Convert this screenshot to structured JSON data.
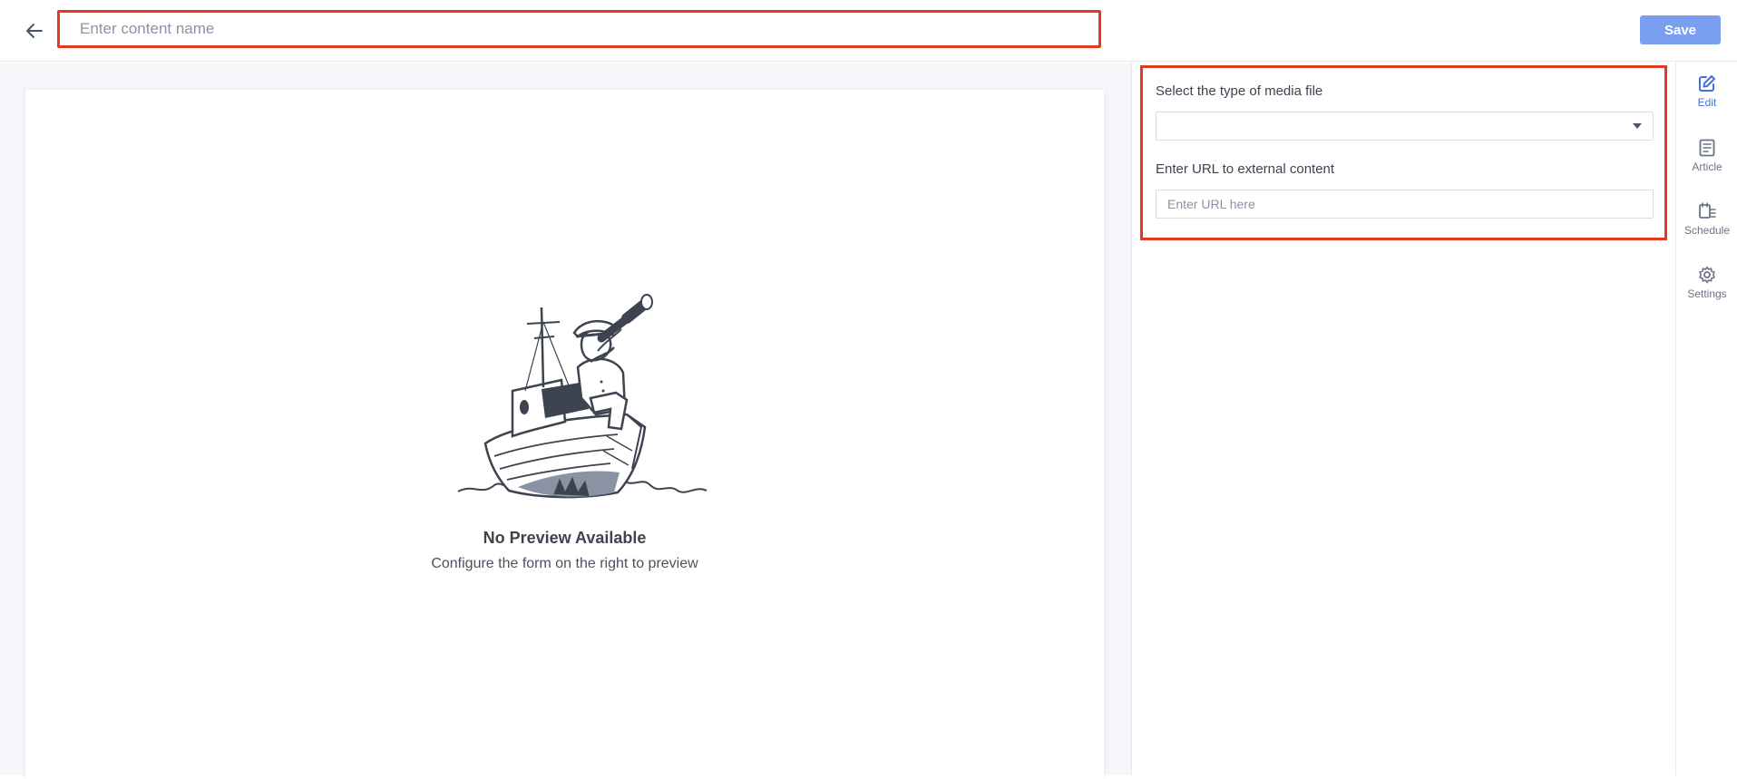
{
  "header": {
    "content_name_placeholder": "Enter content name",
    "save_label": "Save",
    "save_color": "#7a9ff0"
  },
  "preview": {
    "title": "No Preview Available",
    "subtitle": "Configure the form on the right to preview",
    "illustration_icon": "sailor-boat-telescope-illustration"
  },
  "form": {
    "media_type_label": "Select the type of media file",
    "media_type_value": "",
    "url_label": "Enter URL to external content",
    "url_placeholder": "Enter URL here",
    "highlight_color": "#e03a1f"
  },
  "rail": {
    "items": [
      {
        "label": "Edit",
        "icon": "edit-icon",
        "active": true
      },
      {
        "label": "Article",
        "icon": "article-icon",
        "active": false
      },
      {
        "label": "Schedule",
        "icon": "schedule-icon",
        "active": false
      },
      {
        "label": "Settings",
        "icon": "settings-icon",
        "active": false
      }
    ],
    "active_color": "#3f6fe0"
  }
}
